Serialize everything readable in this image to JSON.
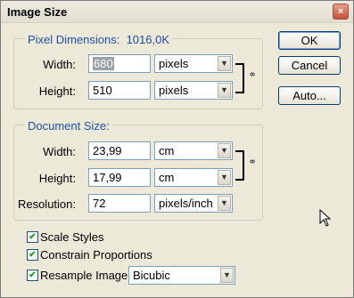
{
  "window": {
    "title": "Image Size",
    "close_glyph": "×"
  },
  "pixel_dimensions": {
    "legend": "Pixel Dimensions:",
    "size": "1016,0K",
    "width_label": "Width:",
    "width_value": "680",
    "width_unit": "pixels",
    "height_label": "Height:",
    "height_value": "510",
    "height_unit": "pixels"
  },
  "document_size": {
    "legend": "Document Size:",
    "width_label": "Width:",
    "width_value": "23,99",
    "width_unit": "cm",
    "height_label": "Height:",
    "height_value": "17,99",
    "height_unit": "cm",
    "resolution_label": "Resolution:",
    "resolution_value": "72",
    "resolution_unit": "pixels/inch"
  },
  "buttons": {
    "ok": "OK",
    "cancel": "Cancel",
    "auto": "Auto..."
  },
  "options": {
    "scale_styles": {
      "label": "Scale Styles",
      "checked": true
    },
    "constrain": {
      "label": "Constrain Proportions",
      "checked": true
    },
    "resample": {
      "label": "Resample Image:",
      "checked": true,
      "method": "Bicubic"
    }
  },
  "icons": {
    "dropdown": "chevron-down-icon",
    "link": "chain-link-icon",
    "check": "checkmark-icon"
  }
}
